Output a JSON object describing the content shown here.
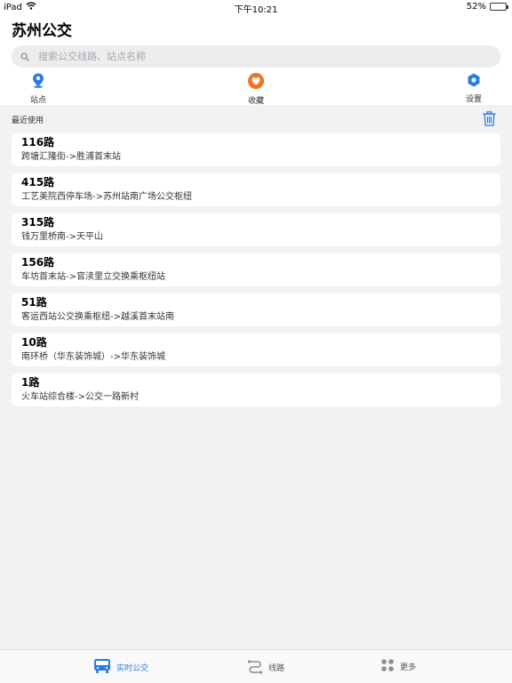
{
  "status_bar": {
    "device": "iPad",
    "time": "下午10:21",
    "battery": "52%",
    "battery_level": 0.52
  },
  "header": {
    "title": "苏州公交"
  },
  "search": {
    "placeholder": "搜索公交线路、站点名称",
    "value": ""
  },
  "quick_actions": [
    {
      "label": "站点",
      "icon": "location-pin-icon",
      "color": "#2a7be4"
    },
    {
      "label": "收藏",
      "icon": "heart-icon",
      "color": "#f07423"
    },
    {
      "label": "设置",
      "icon": "gear-icon",
      "color": "#2a7be4"
    }
  ],
  "recent": {
    "label": "最近使用",
    "clear_icon": "trash-icon",
    "routes": [
      {
        "name": "116路",
        "desc": "跨塘汇隆街->胜浦首末站"
      },
      {
        "name": "415路",
        "desc": "工艺美院西停车场->苏州站南广场公交枢纽"
      },
      {
        "name": "315路",
        "desc": "钱万里桥南->天平山"
      },
      {
        "name": "156路",
        "desc": "车坊首末站->官渎里立交换乘枢纽站"
      },
      {
        "name": "51路",
        "desc": "客运西站公交换乘枢纽->越溪首末站南"
      },
      {
        "name": "10路",
        "desc": "南环桥（华东装饰城）->华东装饰城"
      },
      {
        "name": "1路",
        "desc": "火车站综合楼->公交一路新村"
      }
    ]
  },
  "tabs": [
    {
      "label": "实时公交",
      "icon": "bus-icon",
      "active": true
    },
    {
      "label": "线路",
      "icon": "route-icon",
      "active": false
    },
    {
      "label": "更多",
      "icon": "grid-dots-icon",
      "active": false
    }
  ],
  "colors": {
    "accent": "#2a7be4",
    "favorite": "#f07423",
    "background": "#f2f2f4"
  }
}
